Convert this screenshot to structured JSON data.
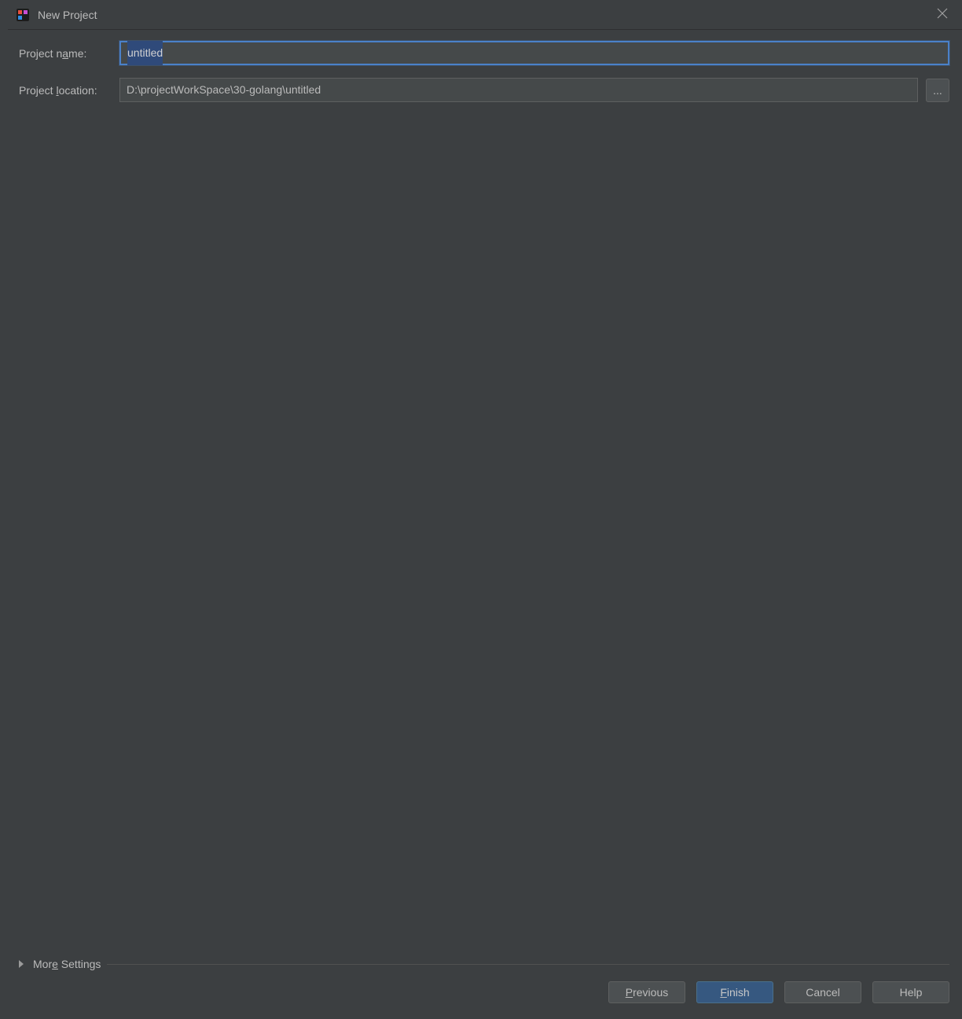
{
  "dialog": {
    "title": "New Project"
  },
  "form": {
    "projectNameLabelPre": "Project n",
    "projectNameLabelUnderline": "a",
    "projectNameLabelPost": "me:",
    "projectNameValue": "untitled",
    "projectLocationLabelPre": "Project ",
    "projectLocationLabelUnderline": "l",
    "projectLocationLabelPost": "ocation:",
    "projectLocationValue": "D:\\projectWorkSpace\\30-golang\\untitled",
    "browseLabel": "..."
  },
  "moreSettings": {
    "labelPre": "Mor",
    "labelUnderline": "e",
    "labelPost": " Settings"
  },
  "buttons": {
    "previousUnderline": "P",
    "previousPost": "revious",
    "finishUnderline": "F",
    "finishPost": "inish",
    "cancel": "Cancel",
    "help": "Help"
  }
}
